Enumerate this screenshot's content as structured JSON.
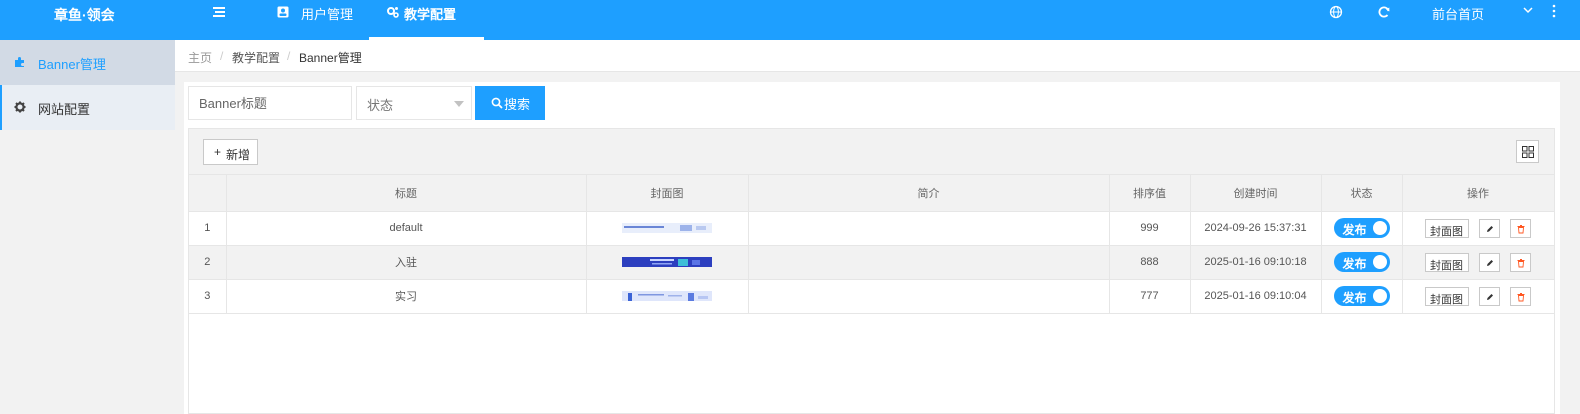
{
  "app": {
    "title": "章鱼·领会"
  },
  "header": {
    "nav": [
      {
        "label": "用户管理",
        "icon": "user-card-icon"
      },
      {
        "label": "教学配置",
        "icon": "gears-icon"
      }
    ],
    "front_link": "前台首页",
    "icons": [
      "menu-icon",
      "globe-icon",
      "refresh-icon",
      "chevron-down-icon",
      "more-vertical-icon"
    ]
  },
  "sidebar": {
    "items": [
      {
        "label": "Banner管理",
        "icon": "puzzle-icon",
        "active": true
      },
      {
        "label": "网站配置",
        "icon": "gear-icon",
        "active": false
      }
    ]
  },
  "breadcrumb": {
    "items": [
      "主页",
      "教学配置",
      "Banner管理"
    ],
    "separator": "/"
  },
  "search": {
    "title_placeholder": "Banner标题",
    "status_placeholder": "状态",
    "button_label": "搜索"
  },
  "toolbar": {
    "add_label": "新增"
  },
  "table": {
    "headers": [
      "",
      "标题",
      "封面图",
      "简介",
      "排序值",
      "创建时间",
      "状态",
      "操作"
    ],
    "rows": [
      {
        "index": "1",
        "title": "default",
        "intro": "",
        "sort": "999",
        "created": "2024-09-26 15:37:31",
        "status": "发布"
      },
      {
        "index": "2",
        "title": "入驻",
        "intro": "",
        "sort": "888",
        "created": "2025-01-16 09:10:18",
        "status": "发布"
      },
      {
        "index": "3",
        "title": "实习",
        "intro": "",
        "sort": "777",
        "created": "2025-01-16 09:10:04",
        "status": "发布"
      }
    ],
    "action_cover_label": "封面图"
  },
  "colors": {
    "accent": "#1e9fff",
    "danger": "#ff5722",
    "border": "#e6e6e6",
    "stripe": "#f2f2f2"
  }
}
